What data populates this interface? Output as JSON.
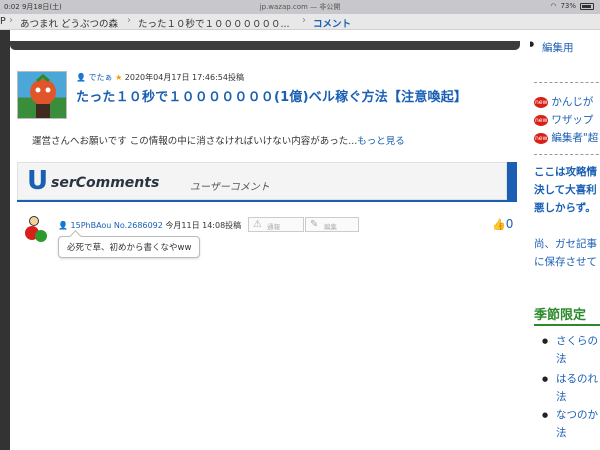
{
  "status": {
    "time": "0:02",
    "date": "9月18日(土)",
    "url": "jp.wazap.com",
    "url_suffix": "— 非公開",
    "battery": "73%"
  },
  "breadcrumb": {
    "items": [
      "P",
      "あつまれ どうぶつの森",
      "たった１０秒で１０００００００..."
    ],
    "current": "コメント"
  },
  "post": {
    "author": "でたぁ",
    "posted_at": "2020年04月17日 17:46:54投稿",
    "title": "たった１０秒で１０００００００(1億)ベル稼ぐ方法【注意喚起】",
    "body": "運営さんへお願いです  この情報の中に消さなければいけない内容があった...",
    "more_link": "もっと見る"
  },
  "comments_banner": {
    "logo": "U",
    "title": "serComments",
    "subtitle": "ユーザーコメント"
  },
  "comment": {
    "user_id": "15PhBAou",
    "number": "No.2686092",
    "posted_at": "今月11日 14:08投稿",
    "report_label": "通報",
    "edit_label": "編集",
    "text": "必死で草、初めから書くなやww",
    "likes": "0"
  },
  "sidebar": {
    "top_item": "編集用",
    "new_links": [
      "かんじが",
      "ワザップ",
      "編集者\"超"
    ],
    "warning_lines": [
      "ここは攻略情",
      "決して大喜利",
      "悪しからず。"
    ],
    "note_lines": [
      "尚、ガセ記事",
      "に保存させて"
    ],
    "season_heading": "季節限定",
    "season_items": [
      {
        "line1": "さくらの",
        "line2": "法"
      },
      {
        "line1": "はるのれ",
        "line2": "法"
      },
      {
        "line1": "なつのか",
        "line2": "法"
      }
    ]
  }
}
